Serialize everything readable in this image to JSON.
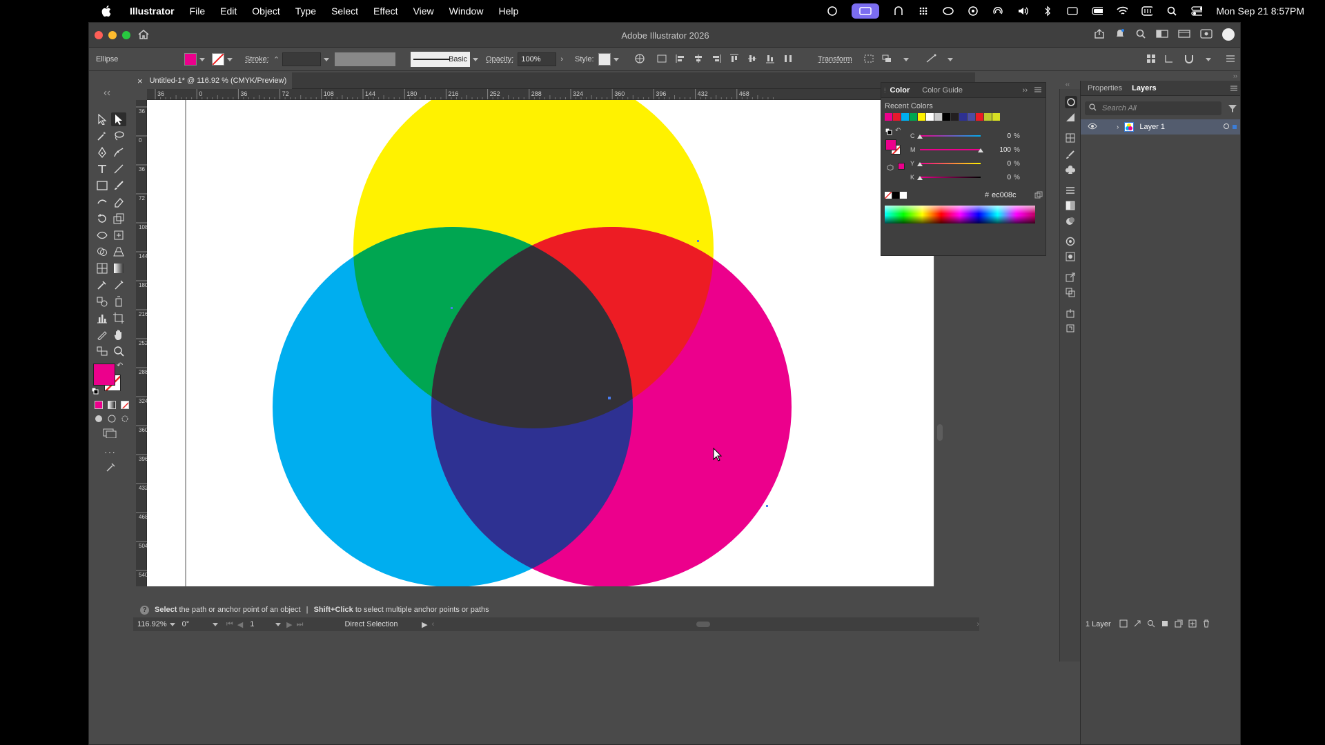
{
  "menubar": {
    "app_name": "Illustrator",
    "items": [
      "File",
      "Edit",
      "Object",
      "Type",
      "Select",
      "Effect",
      "View",
      "Window",
      "Help"
    ],
    "datetime": "Mon Sep 21  8:57PM"
  },
  "window": {
    "title": "Adobe Illustrator 2026"
  },
  "control_bar": {
    "selection_type": "Ellipse",
    "fill_color": "#ec008c",
    "stroke_label": "Stroke:",
    "stroke_style": "Basic",
    "opacity_label": "Opacity:",
    "opacity_value": "100%",
    "style_label": "Style:",
    "transform_label": "Transform"
  },
  "document_tab": {
    "title": "Untitled-1* @ 116.92 % (CMYK/Preview)",
    "close": "×"
  },
  "ruler": {
    "top_labels": [
      "36",
      "0",
      "36",
      "72",
      "108",
      "144",
      "180",
      "216",
      "252",
      "288",
      "324",
      "360",
      "396",
      "432",
      "468"
    ],
    "left_labels": [
      "3 6",
      "0",
      "3 6",
      "7 2",
      "1 0 8",
      "1 4 4",
      "1 8 0",
      "2 1 6",
      "2 5 2",
      "2 8 8",
      "3 2 4",
      "3 6 0",
      "3 9 6",
      "4 3 2",
      "4 6 8",
      "5 0 4",
      "5 4 0"
    ]
  },
  "color_panel": {
    "tab_color": "Color",
    "tab_color_guide": "Color Guide",
    "recent_label": "Recent Colors",
    "recent_colors": [
      "#ec008c",
      "#e8192c",
      "#00aeef",
      "#00a651",
      "#fff200",
      "#ffffff",
      "#cccccc",
      "#000000",
      "#231f20",
      "#2e3192",
      "#4b4ea3",
      "#ec1c24",
      "#bdcb2c",
      "#d7df23"
    ],
    "sliders": [
      {
        "label": "C",
        "value": "0",
        "color": "#00aeef"
      },
      {
        "label": "M",
        "value": "100",
        "color": "#ec008c"
      },
      {
        "label": "Y",
        "value": "0",
        "color": "#fff200"
      },
      {
        "label": "K",
        "value": "0",
        "color": "#000000"
      }
    ],
    "pct": "%",
    "hex_prefix": "#",
    "hex_value": "ec008c"
  },
  "right_panel": {
    "tab_properties": "Properties",
    "tab_layers": "Layers",
    "search_placeholder": "Search All",
    "layer_name": "Layer 1",
    "layer_count": "1 Layer"
  },
  "status": {
    "tip_bold1": "Select",
    "tip_text1": "the path or anchor point of an object",
    "separator": "|",
    "tip_bold2": "Shift+Click",
    "tip_text2": "to select multiple anchor points or paths"
  },
  "bottom": {
    "zoom": "116.92%",
    "rotation": "0°",
    "artboard_number": "1",
    "tool_name": "Direct Selection"
  },
  "artwork": {
    "yellow": "#fff200",
    "cyan": "#00aeef",
    "magenta": "#ec008c",
    "green": "#00a651",
    "red": "#ed1c24",
    "blue": "#2e3192",
    "black": "#333136"
  }
}
